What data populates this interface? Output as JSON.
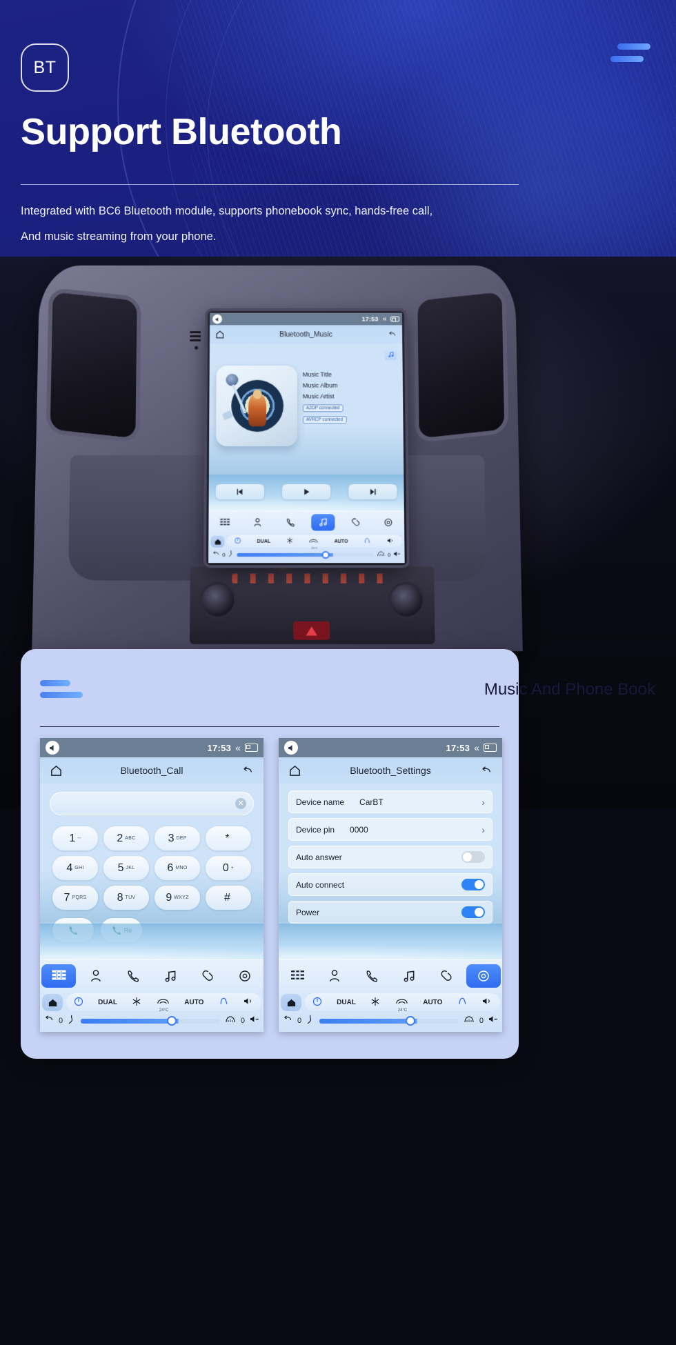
{
  "hero": {
    "badge_text": "BT",
    "title": "Support Bluetooth",
    "desc_line1": "Integrated with BC6 Bluetooth module, supports phonebook sync, hands-free call,",
    "desc_line2": "And music streaming from your phone.",
    "accent_color": "#4d7ef2",
    "background_color": "#1d2383"
  },
  "car_screen": {
    "statusbar": {
      "time": "17:53",
      "speaker_icon": "volume-icon",
      "chevron_icon": "chevron-up-icon",
      "window_icon": "window-icon"
    },
    "app_title": "Bluetooth_Music",
    "home_icon": "home-icon",
    "back_icon": "back-icon",
    "note_button_icon": "music-note-icon",
    "track": {
      "title": "Music Title",
      "album": "Music Album",
      "artist": "Music Artist",
      "badges": [
        "A2DP connected",
        "AVRCP connected"
      ]
    },
    "controls": [
      "previous-icon",
      "play-icon",
      "next-icon"
    ],
    "funcbar": [
      {
        "name": "apps-icon",
        "active": false
      },
      {
        "name": "contacts-icon",
        "active": false
      },
      {
        "name": "phone-icon",
        "active": false
      },
      {
        "name": "music-icon",
        "active": true
      },
      {
        "name": "link-icon",
        "active": false
      },
      {
        "name": "settings-icon",
        "active": false
      }
    ],
    "climate": {
      "home_icon": "home-icon",
      "power_icon": "power-icon",
      "dual_label": "DUAL",
      "snow_icon": "snowflake-icon",
      "defrost_icon": "defrost-icon",
      "auto_label": "AUTO",
      "seat_icon": "seat-icon",
      "volume_up_icon": "volume-up-icon",
      "temperature": "24°C",
      "back_icon": "back-arrow-icon",
      "left_value": "0",
      "right_value": "0",
      "fan_icon": "fan-icon",
      "fan_level_icon": "fan-level-icon",
      "windshield_icon": "windshield-icon",
      "volume_down_icon": "volume-down-icon"
    }
  },
  "bottom_card": {
    "title": "Music And Phone Book",
    "accent_color": "#4d7ef2"
  },
  "call_screen": {
    "statusbar": {
      "time": "17:53"
    },
    "app_title": "Bluetooth_Call",
    "home_icon": "home-icon",
    "back_icon": "back-icon",
    "dial_value": "",
    "clear_icon": "clear-icon",
    "keys": [
      {
        "big": "1",
        "sub": "--"
      },
      {
        "big": "2",
        "sub": "ABC"
      },
      {
        "big": "3",
        "sub": "DEF"
      },
      {
        "big": "*",
        "sub": ""
      },
      {
        "big": "4",
        "sub": "GHI"
      },
      {
        "big": "5",
        "sub": "JKL"
      },
      {
        "big": "6",
        "sub": "MNO"
      },
      {
        "big": "0",
        "sub": "+"
      },
      {
        "big": "7",
        "sub": "PQRS"
      },
      {
        "big": "8",
        "sub": "TUV"
      },
      {
        "big": "9",
        "sub": "WXYZ"
      },
      {
        "big": "#",
        "sub": ""
      }
    ],
    "call_button": {
      "icon": "phone-icon",
      "label": ""
    },
    "redial_button": {
      "icon": "phone-icon",
      "label": "Re"
    },
    "funcbar": [
      {
        "name": "apps-icon",
        "active": true
      },
      {
        "name": "contacts-icon",
        "active": false
      },
      {
        "name": "phone-icon",
        "active": false
      },
      {
        "name": "music-icon",
        "active": false
      },
      {
        "name": "link-icon",
        "active": false
      },
      {
        "name": "settings-icon",
        "active": false
      }
    ],
    "climate": {
      "dual_label": "DUAL",
      "auto_label": "AUTO",
      "temperature": "24°C",
      "left_value": "0",
      "right_value": "0"
    }
  },
  "settings_screen": {
    "statusbar": {
      "time": "17:53"
    },
    "app_title": "Bluetooth_Settings",
    "home_icon": "home-icon",
    "back_icon": "back-icon",
    "rows": [
      {
        "label": "Device name",
        "value": "CarBT",
        "type": "chevron"
      },
      {
        "label": "Device pin",
        "value": "0000",
        "type": "chevron"
      },
      {
        "label": "Auto answer",
        "value": "",
        "type": "toggle",
        "on": false
      },
      {
        "label": "Auto connect",
        "value": "",
        "type": "toggle",
        "on": true
      },
      {
        "label": "Power",
        "value": "",
        "type": "toggle",
        "on": true
      }
    ],
    "funcbar": [
      {
        "name": "apps-icon",
        "active": false
      },
      {
        "name": "contacts-icon",
        "active": false
      },
      {
        "name": "phone-icon",
        "active": false
      },
      {
        "name": "music-icon",
        "active": false
      },
      {
        "name": "link-icon",
        "active": false
      },
      {
        "name": "settings-icon",
        "active": true
      }
    ],
    "climate": {
      "dual_label": "DUAL",
      "auto_label": "AUTO",
      "temperature": "24°C",
      "left_value": "0",
      "right_value": "0"
    }
  }
}
